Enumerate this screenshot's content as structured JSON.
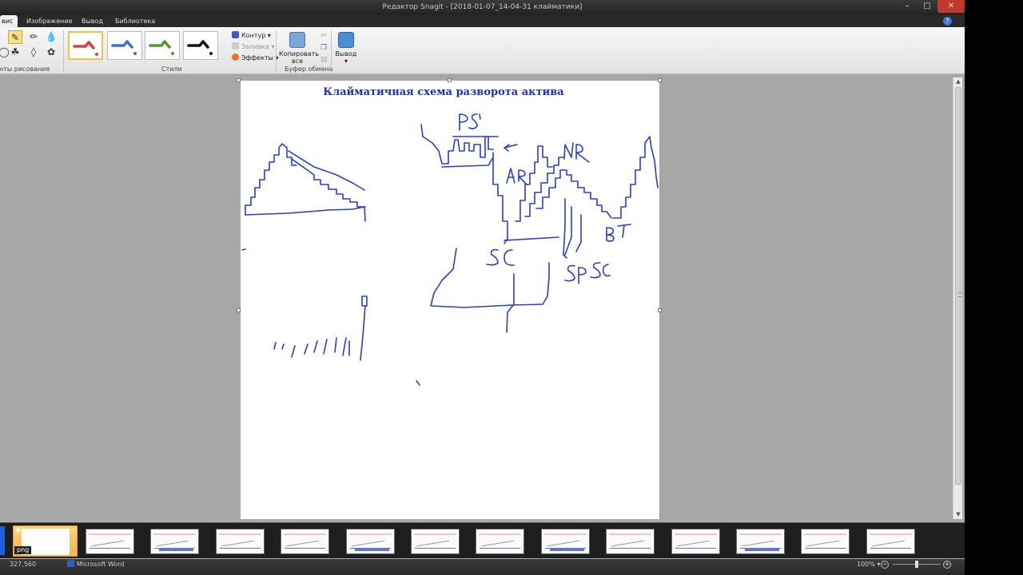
{
  "window": {
    "title": "Редактор Snagit - [2018-01-07_14-04-31 клайматики]",
    "controls": [
      "minimize-icon",
      "maximize-icon",
      "close-icon"
    ]
  },
  "tabs": [
    {
      "label": "вис",
      "active": true
    },
    {
      "label": "Изображение",
      "active": false
    },
    {
      "label": "Вывод",
      "active": false
    },
    {
      "label": "Библиотека",
      "active": false
    }
  ],
  "ribbon": {
    "tools_group_label": "нты рисования",
    "styles_group_label": "Стили",
    "style_colors": [
      "#e03c3c",
      "#3c6fd1",
      "#4c9a2a",
      "#111111"
    ],
    "contour_label": "Контур",
    "fill_label": "Заливка",
    "effects_label": "Эффекты",
    "copy_all_label": "Копировать все",
    "clipboard_group_label": "Буфер обмена",
    "output_label": "Вывод"
  },
  "canvas": {
    "title": "Клайматичная схема разворота актива",
    "ink_color": "#2a3fc8",
    "annotations": [
      "PS",
      "NR",
      "AR",
      "BT",
      "SC",
      "SP",
      "SC"
    ]
  },
  "tray": {
    "selected_badge": "png",
    "thumbnail_count": 14
  },
  "status": {
    "coords": "327,560",
    "app": "Microsoft Word",
    "zoom": "100%"
  }
}
